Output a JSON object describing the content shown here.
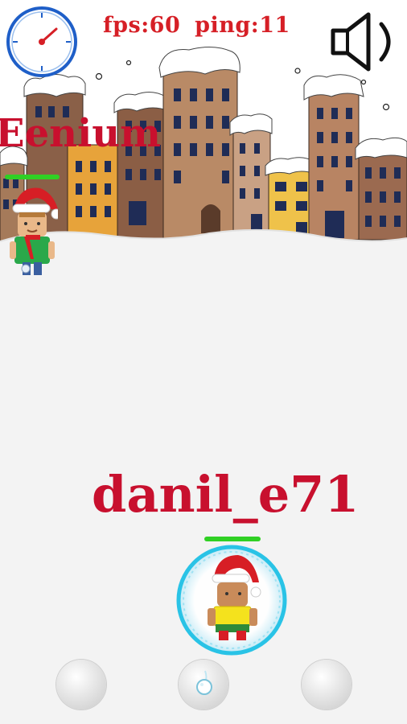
{
  "hud": {
    "fps": "fps:60",
    "ping": "ping:11",
    "clock_icon": "stopwatch-icon",
    "sound_icon": "speaker-icon"
  },
  "players": {
    "opponent": {
      "name": "Eenium",
      "health": 1.0
    },
    "me": {
      "name": "danil_e71",
      "health": 1.0
    }
  },
  "controls": {
    "left": "snowball-button-left-icon",
    "middle": "throw-snowball-icon",
    "right": "snowball-button-right-icon"
  },
  "colors": {
    "name_red": "#c8102e",
    "hud_red": "#d61f26",
    "health_green": "#30d024",
    "shield_cyan": "#29c3e6"
  }
}
